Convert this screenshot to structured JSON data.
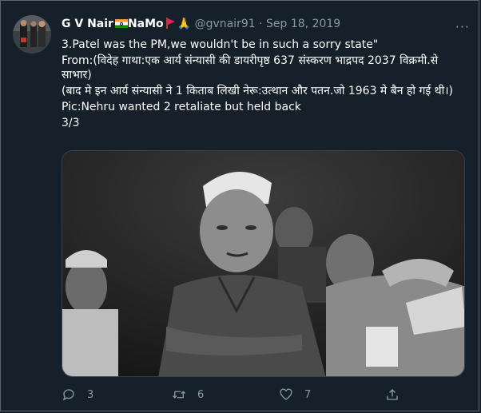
{
  "tweet": {
    "display_name": "G V Nair",
    "name_suffix": "NaMo",
    "emoji_after_flag": "🙏",
    "handle": "@gvnair91",
    "separator": "·",
    "date": "Sep 18, 2019",
    "more_label": "···",
    "text_lines": [
      "3.Patel was the PM,we wouldn't be in such a sorry state\"",
      "From:(विदेह गाथा:एक आर्य संन्यासी की डायरीपृष्ठ 637 संस्करण भाद्रपद 2037 विक्रमी.से साभार)",
      "(बाद मे इन आर्य संन्यासी ने 1 किताब लिखी नेरू:उत्थान और पतन.जो 1963 मे बैन हो गई थी।)",
      "Pic:Nehru wanted 2 retaliate but held back",
      "3/3"
    ],
    "actions": {
      "replies": "3",
      "retweets": "6",
      "likes": "7"
    }
  },
  "icons": [
    "reply-icon",
    "retweet-icon",
    "like-icon",
    "share-icon",
    "india-flag-icon",
    "red-flag-icon",
    "more-icon"
  ],
  "colors": {
    "background": "#15202b",
    "text": "#ffffff",
    "muted": "#8899a6",
    "border": "#38444d"
  }
}
